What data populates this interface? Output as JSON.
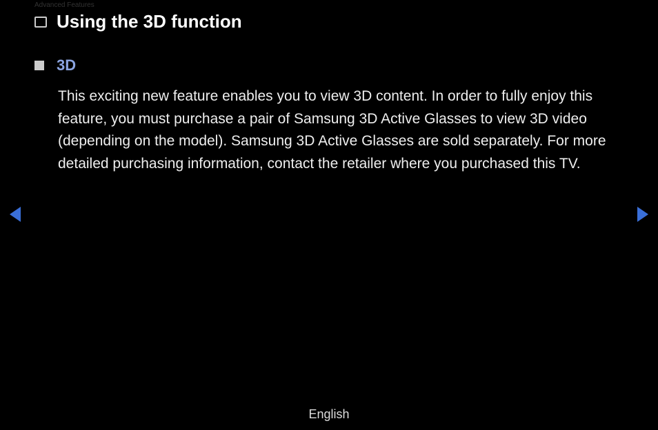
{
  "breadcrumb": "Advanced Features",
  "page_title": "Using the 3D function",
  "section": {
    "title": "3D",
    "body": "This exciting new feature enables you to view 3D content. In order to fully enjoy this feature, you must purchase a pair of Samsung 3D Active Glasses to view 3D video (depending on the model). Samsung 3D Active Glasses are sold separately. For more detailed purchasing information, contact the retailer where you purchased this TV."
  },
  "footer": {
    "language": "English"
  }
}
